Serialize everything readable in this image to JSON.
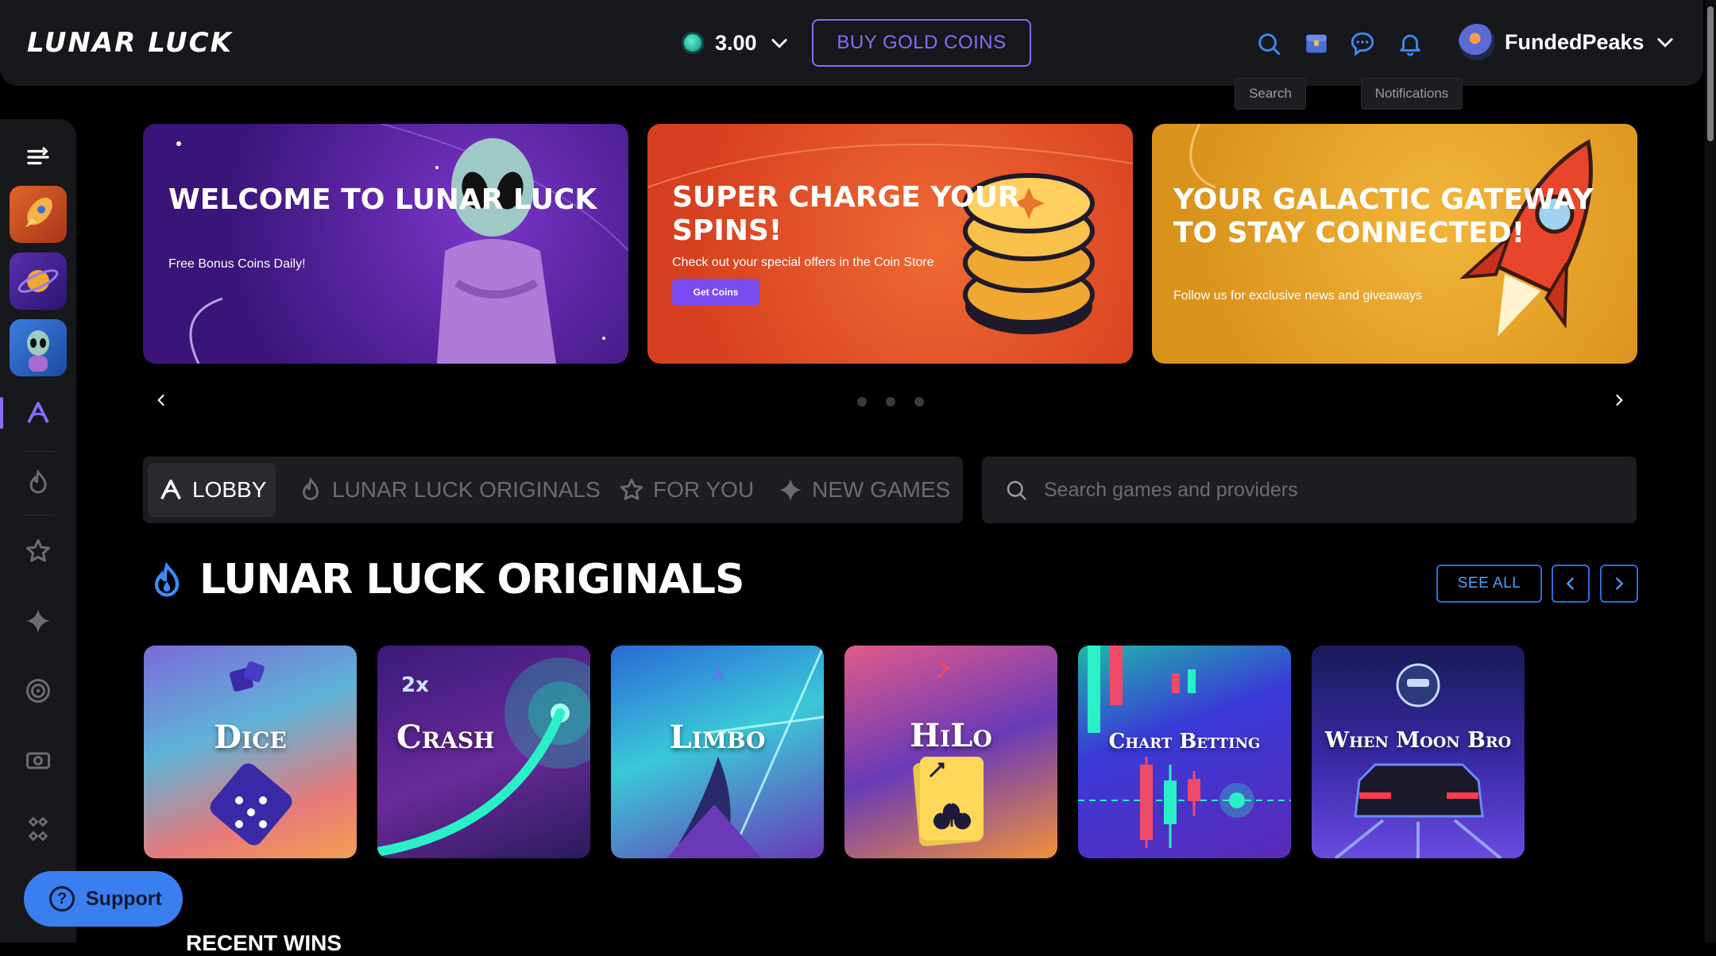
{
  "header": {
    "logo_text": "LUNAR LUCK",
    "balance": "3.00",
    "buy_button": "BUY GOLD COINS",
    "username": "FundedPeaks",
    "tooltip_search": "Search",
    "tooltip_notifications": "Notifications"
  },
  "banners": [
    {
      "title": "WELCOME TO LUNAR LUCK",
      "subtitle": "Free Bonus Coins Daily!"
    },
    {
      "title": "SUPER CHARGE YOUR SPINS!",
      "subtitle": "Check out your special offers in the Coin Store",
      "button": "Get Coins"
    },
    {
      "title": "YOUR GALACTIC GATEWAY TO STAY CONNECTED!",
      "subtitle": "Follow us for exclusive news and giveaways"
    }
  ],
  "tabs": [
    {
      "label": "LOBBY",
      "active": true
    },
    {
      "label": "LUNAR LUCK ORIGINALS",
      "active": false
    },
    {
      "label": "FOR YOU",
      "active": false
    },
    {
      "label": "NEW GAMES",
      "active": false
    }
  ],
  "search": {
    "placeholder": "Search games and providers"
  },
  "section": {
    "title": "LUNAR LUCK ORIGINALS",
    "see_all": "SEE ALL"
  },
  "games": [
    {
      "name": "Dice"
    },
    {
      "name": "Crash"
    },
    {
      "name": "Limbo"
    },
    {
      "name": "HiLo"
    },
    {
      "name": "Chart Betting"
    },
    {
      "name": "When Moon Bro"
    }
  ],
  "support": {
    "label": "Support"
  },
  "next_section": {
    "title": "RECENT WINS"
  },
  "colors": {
    "accent": "#8b6cf7",
    "link": "#2b6fd6",
    "background": "#000000",
    "panel": "#17181c"
  }
}
